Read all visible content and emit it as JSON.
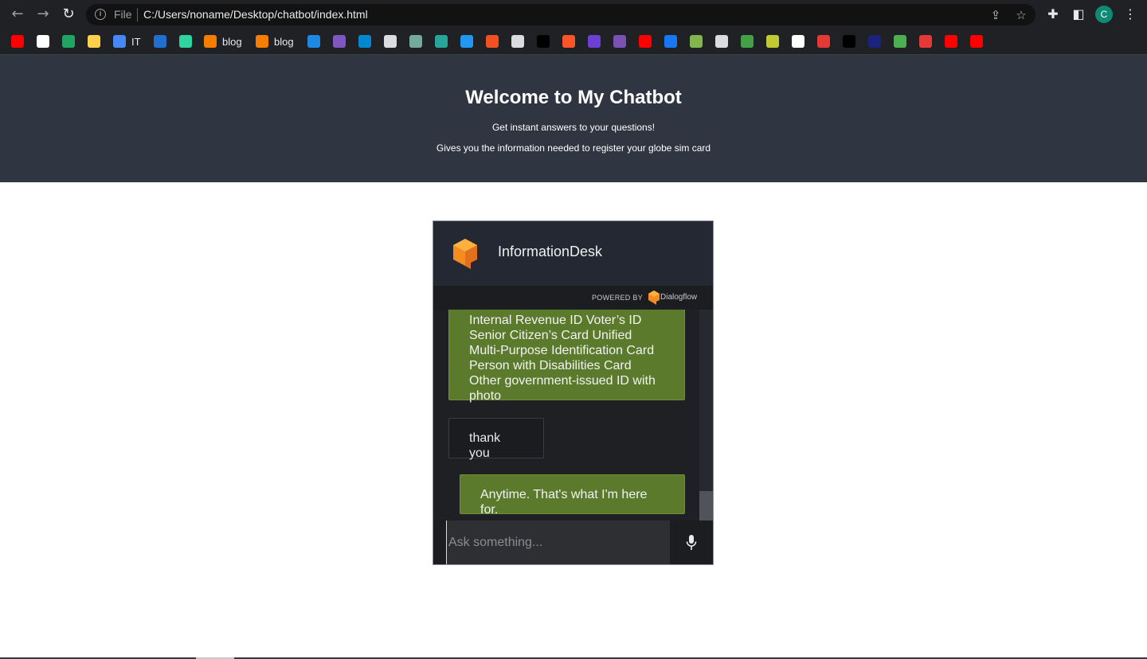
{
  "browser": {
    "scheme": "File",
    "url": "C:/Users/noname/Desktop/chatbot/index.html",
    "profile_initial": "C",
    "bookmarks": [
      {
        "icon": "youtube-icon",
        "label": "",
        "color": "#ff0000"
      },
      {
        "icon": "github-icon",
        "label": "",
        "color": "#ffffff"
      },
      {
        "icon": "google-drive-icon",
        "label": "",
        "color": "#1fa463"
      },
      {
        "icon": "google-drive-icon",
        "label": "",
        "color": "#ffd04b"
      },
      {
        "icon": "google-drive-icon",
        "label": "IT",
        "color": "#4688f4"
      },
      {
        "icon": "paypal-icon",
        "label": "",
        "color": "#1f6fd1"
      },
      {
        "icon": "pluralsight-icon",
        "label": "",
        "color": "#2dd4a0"
      },
      {
        "icon": "blogger-icon",
        "label": "blog",
        "color": "#f57d00"
      },
      {
        "icon": "blogger-icon",
        "label": "blog",
        "color": "#f57d00"
      },
      {
        "icon": "d-icon",
        "label": "",
        "color": "#1e88e5"
      },
      {
        "icon": "hex-icon",
        "label": "",
        "color": "#7e57c2"
      },
      {
        "icon": "wn-icon",
        "label": "",
        "color": "#0288d1"
      },
      {
        "icon": "globe-icon",
        "label": "",
        "color": "#dadce0"
      },
      {
        "icon": "openai-icon",
        "label": "",
        "color": "#74aa9c"
      },
      {
        "icon": "cube-icon",
        "label": "",
        "color": "#26a69a"
      },
      {
        "icon": "vscode-icon",
        "label": "",
        "color": "#2196f3"
      },
      {
        "icon": "microsoft-icon",
        "label": "",
        "color": "#f25022"
      },
      {
        "icon": "globe-icon",
        "label": "",
        "color": "#dadce0"
      },
      {
        "icon": "r-icon",
        "label": "",
        "color": "#000000"
      },
      {
        "icon": "brave-icon",
        "label": "",
        "color": "#fb542b"
      },
      {
        "icon": "swirl-icon",
        "label": "",
        "color": "#6c3fd6"
      },
      {
        "icon": "bootstrap-icon",
        "label": "",
        "color": "#7952b3"
      },
      {
        "icon": "youtube-icon",
        "label": "",
        "color": "#ff0000"
      },
      {
        "icon": "facebook-icon",
        "label": "",
        "color": "#1877f2"
      },
      {
        "icon": "chess-icon",
        "label": "",
        "color": "#81b64c"
      },
      {
        "icon": "globe-icon",
        "label": "",
        "color": "#dadce0"
      },
      {
        "icon": "box-icon",
        "label": "",
        "color": "#43a047"
      },
      {
        "icon": "x-icon",
        "label": "",
        "color": "#c0ca33"
      },
      {
        "icon": "a-icon",
        "label": "",
        "color": "#ffffff"
      },
      {
        "icon": "wrench-icon",
        "label": "",
        "color": "#e53935"
      },
      {
        "icon": "ff-icon",
        "label": "",
        "color": "#000000"
      },
      {
        "icon": "xml-icon",
        "label": "",
        "color": "#1a237e"
      },
      {
        "icon": "leaf-icon",
        "label": "",
        "color": "#4caf50"
      },
      {
        "icon": "lock-icon",
        "label": "",
        "color": "#e53935"
      },
      {
        "icon": "youtube-icon",
        "label": "",
        "color": "#ff0000"
      },
      {
        "icon": "youtube-icon",
        "label": "",
        "color": "#ff0000"
      }
    ]
  },
  "hero": {
    "title": "Welcome to My Chatbot",
    "subtitle1": "Get instant answers to your questions!",
    "subtitle2": "Gives you the information needed to register your globe sim card"
  },
  "chat": {
    "agent_name": "InformationDesk",
    "powered_by": "POWERED BY",
    "powered_brand": "Dialogflow",
    "messages": [
      {
        "sender": "agent",
        "text": "Internal Revenue ID Voter’s ID Senior Citizen’s Card Unified Multi-Purpose Identification Card Person with Disabilities Card Other government-issued ID with photo"
      },
      {
        "sender": "user",
        "text": "thank you"
      },
      {
        "sender": "agent",
        "text": "Anytime. That's what I'm here for."
      }
    ],
    "input_placeholder": "Ask something...",
    "input_value": ""
  },
  "colors": {
    "hero_bg": "#2f3641",
    "agent_bubble": "#5c7a2c",
    "brand_orange": "#f68c1f"
  }
}
